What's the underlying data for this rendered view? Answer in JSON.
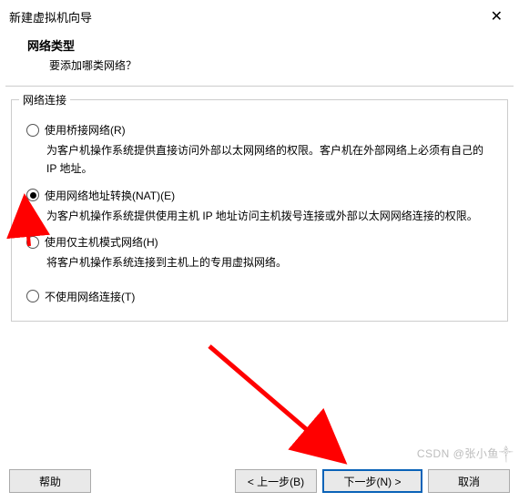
{
  "titlebar": {
    "title": "新建虚拟机向导",
    "close": "✕"
  },
  "header": {
    "title": "网络类型",
    "subtitle": "要添加哪类网络？"
  },
  "fieldset": {
    "legend": "网络连接"
  },
  "options": {
    "bridged": {
      "label": "使用桥接网络(R)",
      "desc": "为客户机操作系统提供直接访问外部以太网网络的权限。客户机在外部网络上必须有自己的 IP 地址。"
    },
    "nat": {
      "label": "使用网络地址转换(NAT)(E)",
      "desc": "为客户机操作系统提供使用主机 IP 地址访问主机拨号连接或外部以太网网络连接的权限。"
    },
    "hostonly": {
      "label": "使用仅主机模式网络(H)",
      "desc": "将客户机操作系统连接到主机上的专用虚拟网络。"
    },
    "none": {
      "label": "不使用网络连接(T)"
    }
  },
  "footer": {
    "help": "帮助",
    "back": "< 上一步(B)",
    "next": "下一步(N) >",
    "cancel": "取消"
  },
  "watermark": "CSDN @张小鱼༒"
}
